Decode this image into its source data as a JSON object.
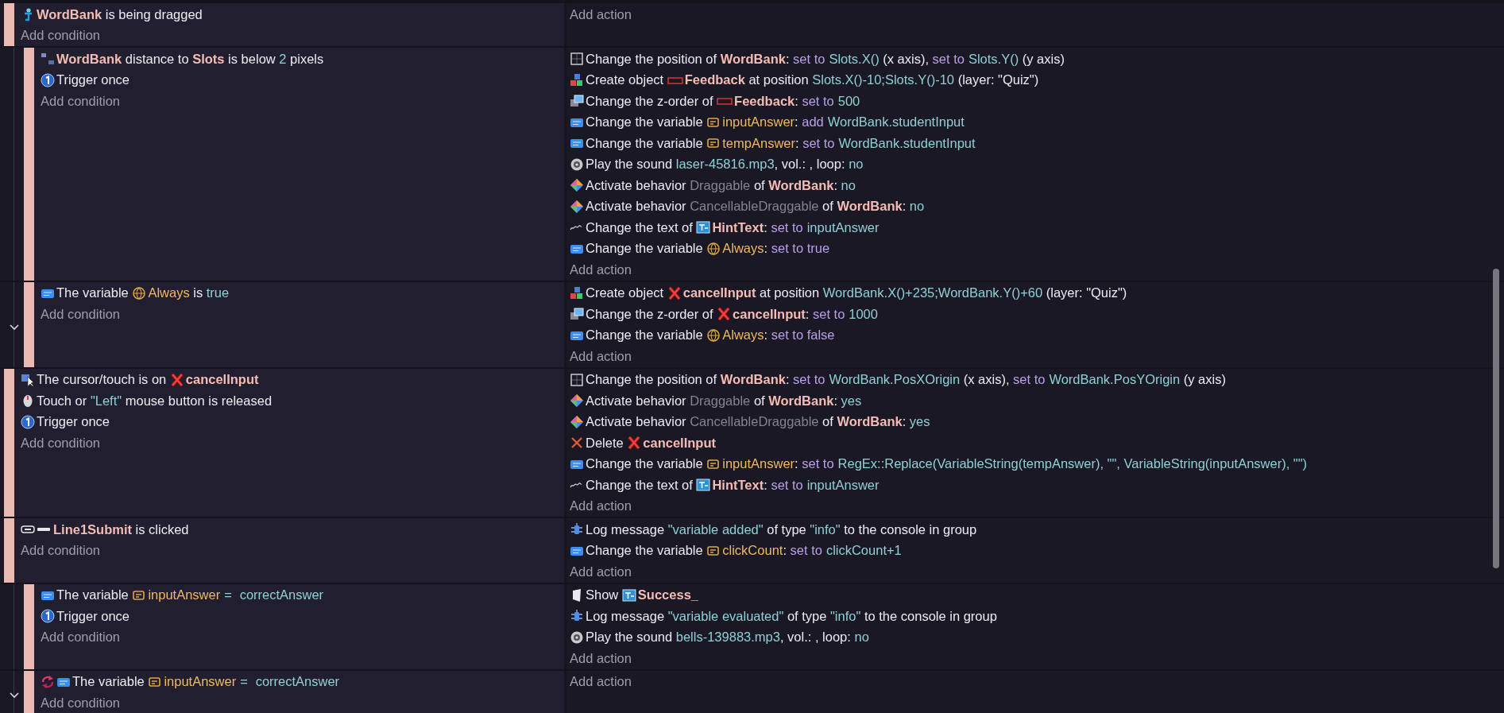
{
  "events": [
    {
      "conditions": [
        {
          "kind": "drag",
          "segments": [
            {
              "kind": "object",
              "text": "WordBank"
            },
            {
              "kind": "plain",
              "text": " is being dragged"
            }
          ]
        }
      ],
      "add_condition": "Add condition",
      "add_action": "Add action",
      "children": [
        {
          "conditions": [
            {
              "kind": "distance",
              "segments": [
                {
                  "kind": "object",
                  "text": "WordBank"
                },
                {
                  "kind": "plain",
                  "text": " distance to "
                },
                {
                  "kind": "object",
                  "text": "Slots"
                },
                {
                  "kind": "plain",
                  "text": " is below "
                },
                {
                  "kind": "value",
                  "text": "2"
                },
                {
                  "kind": "plain",
                  "text": " pixels"
                }
              ]
            },
            {
              "kind": "trigger",
              "segments": [
                {
                  "kind": "plain",
                  "text": "Trigger once"
                }
              ]
            }
          ],
          "add_condition": "Add condition",
          "actions": [
            {
              "kind": "position",
              "segments": [
                {
                  "kind": "plain",
                  "text": "Change the position of "
                },
                {
                  "kind": "object",
                  "text": "WordBank"
                },
                {
                  "kind": "plain",
                  "text": ": "
                },
                {
                  "kind": "operator",
                  "text": "set to"
                },
                {
                  "kind": "value",
                  "text": "Slots.X()"
                },
                {
                  "kind": "plain",
                  "text": " (x axis), "
                },
                {
                  "kind": "operator",
                  "text": "set to"
                },
                {
                  "kind": "value",
                  "text": "Slots.Y()"
                },
                {
                  "kind": "plain",
                  "text": " (y axis)"
                }
              ]
            },
            {
              "kind": "create",
              "segments": [
                {
                  "kind": "plain",
                  "text": "Create object "
                },
                {
                  "kind": "frame"
                },
                {
                  "kind": "object",
                  "text": "Feedback"
                },
                {
                  "kind": "plain",
                  "text": " at position "
                },
                {
                  "kind": "value",
                  "text": "Slots.X()-10;Slots.Y()-10"
                },
                {
                  "kind": "plain",
                  "text": " (layer: \"Quiz\")"
                }
              ]
            },
            {
              "kind": "zorder",
              "segments": [
                {
                  "kind": "plain",
                  "text": "Change the z-order of "
                },
                {
                  "kind": "frame"
                },
                {
                  "kind": "object",
                  "text": "Feedback"
                },
                {
                  "kind": "plain",
                  "text": ": "
                },
                {
                  "kind": "operator",
                  "text": "set to"
                },
                {
                  "kind": "value",
                  "text": "500"
                }
              ]
            },
            {
              "kind": "variable",
              "segments": [
                {
                  "kind": "plain",
                  "text": "Change the variable "
                },
                {
                  "kind": "scenevar"
                },
                {
                  "kind": "variable",
                  "text": "inputAnswer"
                },
                {
                  "kind": "plain",
                  "text": ": "
                },
                {
                  "kind": "operator",
                  "text": "add"
                },
                {
                  "kind": "value",
                  "text": "WordBank.studentInput"
                }
              ]
            },
            {
              "kind": "variable",
              "segments": [
                {
                  "kind": "plain",
                  "text": "Change the variable "
                },
                {
                  "kind": "scenevar"
                },
                {
                  "kind": "variable",
                  "text": "tempAnswer"
                },
                {
                  "kind": "plain",
                  "text": ": "
                },
                {
                  "kind": "operator",
                  "text": "set to"
                },
                {
                  "kind": "value",
                  "text": "WordBank.studentInput"
                }
              ]
            },
            {
              "kind": "sound",
              "segments": [
                {
                  "kind": "plain",
                  "text": "Play the sound "
                },
                {
                  "kind": "value",
                  "text": "laser-45816.mp3"
                },
                {
                  "kind": "plain",
                  "text": ", vol.: , loop: "
                },
                {
                  "kind": "value",
                  "text": "no"
                }
              ]
            },
            {
              "kind": "behavior",
              "segments": [
                {
                  "kind": "plain",
                  "text": "Activate behavior "
                },
                {
                  "kind": "behavior",
                  "text": "Draggable"
                },
                {
                  "kind": "plain",
                  "text": " of "
                },
                {
                  "kind": "object",
                  "text": "WordBank"
                },
                {
                  "kind": "plain",
                  "text": ": "
                },
                {
                  "kind": "value",
                  "text": "no"
                }
              ]
            },
            {
              "kind": "behavior",
              "segments": [
                {
                  "kind": "plain",
                  "text": "Activate behavior "
                },
                {
                  "kind": "behavior",
                  "text": "CancellableDraggable"
                },
                {
                  "kind": "plain",
                  "text": " of "
                },
                {
                  "kind": "object",
                  "text": "WordBank"
                },
                {
                  "kind": "plain",
                  "text": ": "
                },
                {
                  "kind": "value",
                  "text": "no"
                }
              ]
            },
            {
              "kind": "text",
              "segments": [
                {
                  "kind": "plain",
                  "text": "Change the text of "
                },
                {
                  "kind": "textbox"
                },
                {
                  "kind": "object",
                  "text": "HintText"
                },
                {
                  "kind": "plain",
                  "text": ": "
                },
                {
                  "kind": "operator",
                  "text": "set to"
                },
                {
                  "kind": "value",
                  "text": "inputAnswer"
                }
              ]
            },
            {
              "kind": "variable",
              "segments": [
                {
                  "kind": "plain",
                  "text": "Change the variable "
                },
                {
                  "kind": "globe"
                },
                {
                  "kind": "variable",
                  "text": "Always"
                },
                {
                  "kind": "plain",
                  "text": ": "
                },
                {
                  "kind": "operator",
                  "text": "set to true"
                }
              ]
            }
          ],
          "add_action": "Add action"
        },
        {
          "conditions": [
            {
              "kind": "variable",
              "segments": [
                {
                  "kind": "plain",
                  "text": "The variable "
                },
                {
                  "kind": "globe"
                },
                {
                  "kind": "variable",
                  "text": "Always"
                },
                {
                  "kind": "plain",
                  "text": " is "
                },
                {
                  "kind": "value",
                  "text": "true"
                }
              ]
            }
          ],
          "add_condition": "Add condition",
          "actions": [
            {
              "kind": "create",
              "segments": [
                {
                  "kind": "plain",
                  "text": "Create object "
                },
                {
                  "kind": "cross"
                },
                {
                  "kind": "object",
                  "text": "cancelInput"
                },
                {
                  "kind": "plain",
                  "text": " at position "
                },
                {
                  "kind": "value",
                  "text": "WordBank.X()+235;WordBank.Y()+60"
                },
                {
                  "kind": "plain",
                  "text": " (layer: \"Quiz\")"
                }
              ]
            },
            {
              "kind": "zorder",
              "segments": [
                {
                  "kind": "plain",
                  "text": "Change the z-order of "
                },
                {
                  "kind": "cross"
                },
                {
                  "kind": "object",
                  "text": "cancelInput"
                },
                {
                  "kind": "plain",
                  "text": ": "
                },
                {
                  "kind": "operator",
                  "text": "set to"
                },
                {
                  "kind": "value",
                  "text": "1000"
                }
              ]
            },
            {
              "kind": "variable",
              "segments": [
                {
                  "kind": "plain",
                  "text": "Change the variable "
                },
                {
                  "kind": "globe"
                },
                {
                  "kind": "variable",
                  "text": "Always"
                },
                {
                  "kind": "plain",
                  "text": ": "
                },
                {
                  "kind": "operator",
                  "text": "set to false"
                }
              ]
            }
          ],
          "add_action": "Add action"
        }
      ]
    },
    {
      "conditions": [
        {
          "kind": "cursor",
          "segments": [
            {
              "kind": "plain",
              "text": "The cursor/touch is on "
            },
            {
              "kind": "cross"
            },
            {
              "kind": "object",
              "text": "cancelInput"
            }
          ]
        },
        {
          "kind": "mouse",
          "segments": [
            {
              "kind": "plain",
              "text": "Touch or "
            },
            {
              "kind": "value",
              "text": "\"Left\""
            },
            {
              "kind": "plain",
              "text": " mouse button is released"
            }
          ]
        },
        {
          "kind": "trigger",
          "segments": [
            {
              "kind": "plain",
              "text": "Trigger once"
            }
          ]
        }
      ],
      "add_condition": "Add condition",
      "actions": [
        {
          "kind": "position",
          "segments": [
            {
              "kind": "plain",
              "text": "Change the position of "
            },
            {
              "kind": "object",
              "text": "WordBank"
            },
            {
              "kind": "plain",
              "text": ": "
            },
            {
              "kind": "operator",
              "text": "set to"
            },
            {
              "kind": "value",
              "text": "WordBank.PosXOrigin"
            },
            {
              "kind": "plain",
              "text": " (x axis), "
            },
            {
              "kind": "operator",
              "text": "set to"
            },
            {
              "kind": "value",
              "text": "WordBank.PosYOrigin"
            },
            {
              "kind": "plain",
              "text": " (y axis)"
            }
          ]
        },
        {
          "kind": "behavior",
          "segments": [
            {
              "kind": "plain",
              "text": "Activate behavior "
            },
            {
              "kind": "behavior",
              "text": "Draggable"
            },
            {
              "kind": "plain",
              "text": " of "
            },
            {
              "kind": "object",
              "text": "WordBank"
            },
            {
              "kind": "plain",
              "text": ": "
            },
            {
              "kind": "value",
              "text": "yes"
            }
          ]
        },
        {
          "kind": "behavior",
          "segments": [
            {
              "kind": "plain",
              "text": "Activate behavior "
            },
            {
              "kind": "behavior",
              "text": "CancellableDraggable"
            },
            {
              "kind": "plain",
              "text": " of "
            },
            {
              "kind": "object",
              "text": "WordBank"
            },
            {
              "kind": "plain",
              "text": ": "
            },
            {
              "kind": "value",
              "text": "yes"
            }
          ]
        },
        {
          "kind": "delete",
          "segments": [
            {
              "kind": "plain",
              "text": "Delete "
            },
            {
              "kind": "cross"
            },
            {
              "kind": "object",
              "text": "cancelInput"
            }
          ]
        },
        {
          "kind": "variable",
          "segments": [
            {
              "kind": "plain",
              "text": "Change the variable "
            },
            {
              "kind": "scenevar"
            },
            {
              "kind": "variable",
              "text": "inputAnswer"
            },
            {
              "kind": "plain",
              "text": ": "
            },
            {
              "kind": "operator",
              "text": "set to"
            },
            {
              "kind": "value",
              "text": "RegEx::Replace(VariableString(tempAnswer), \"\", VariableString(inputAnswer), \"\")"
            }
          ]
        },
        {
          "kind": "text",
          "segments": [
            {
              "kind": "plain",
              "text": "Change the text of "
            },
            {
              "kind": "textbox"
            },
            {
              "kind": "object",
              "text": "HintText"
            },
            {
              "kind": "plain",
              "text": ": "
            },
            {
              "kind": "operator",
              "text": "set to"
            },
            {
              "kind": "value",
              "text": "inputAnswer"
            }
          ]
        }
      ],
      "add_action": "Add action"
    },
    {
      "conditions": [
        {
          "kind": "button",
          "segments": [
            {
              "kind": "dash"
            },
            {
              "kind": "object",
              "text": "Line1Submit"
            },
            {
              "kind": "plain",
              "text": " is clicked"
            }
          ]
        }
      ],
      "add_condition": "Add condition",
      "actions": [
        {
          "kind": "log",
          "segments": [
            {
              "kind": "plain",
              "text": "Log message "
            },
            {
              "kind": "value",
              "text": "\"variable added\""
            },
            {
              "kind": "plain",
              "text": " of type "
            },
            {
              "kind": "value",
              "text": "\"info\""
            },
            {
              "kind": "plain",
              "text": " to the console in group"
            }
          ]
        },
        {
          "kind": "variable",
          "segments": [
            {
              "kind": "plain",
              "text": "Change the variable "
            },
            {
              "kind": "scenevar"
            },
            {
              "kind": "variable",
              "text": "clickCount"
            },
            {
              "kind": "plain",
              "text": ": "
            },
            {
              "kind": "operator",
              "text": "set to"
            },
            {
              "kind": "value",
              "text": "clickCount+1"
            }
          ]
        }
      ],
      "add_action": "Add action",
      "children": [
        {
          "conditions": [
            {
              "kind": "variable",
              "segments": [
                {
                  "kind": "plain",
                  "text": "The variable "
                },
                {
                  "kind": "scenevar"
                },
                {
                  "kind": "variable",
                  "text": "inputAnswer"
                },
                {
                  "kind": "value",
                  "text": "="
                },
                {
                  "kind": "value",
                  "text": "correctAnswer"
                }
              ]
            },
            {
              "kind": "trigger",
              "segments": [
                {
                  "kind": "plain",
                  "text": "Trigger once"
                }
              ]
            }
          ],
          "add_condition": "Add condition",
          "actions": [
            {
              "kind": "show",
              "segments": [
                {
                  "kind": "plain",
                  "text": "Show "
                },
                {
                  "kind": "textbox"
                },
                {
                  "kind": "object",
                  "text": "Success_"
                }
              ]
            },
            {
              "kind": "log",
              "segments": [
                {
                  "kind": "plain",
                  "text": "Log message "
                },
                {
                  "kind": "value",
                  "text": "\"variable evaluated\""
                },
                {
                  "kind": "plain",
                  "text": " of type "
                },
                {
                  "kind": "value",
                  "text": "\"info\""
                },
                {
                  "kind": "plain",
                  "text": " to the console in group"
                }
              ]
            },
            {
              "kind": "sound",
              "segments": [
                {
                  "kind": "plain",
                  "text": "Play the sound "
                },
                {
                  "kind": "value",
                  "text": "bells-139883.mp3"
                },
                {
                  "kind": "plain",
                  "text": ", vol.: , loop: "
                },
                {
                  "kind": "value",
                  "text": "no"
                }
              ]
            }
          ],
          "add_action": "Add action"
        },
        {
          "conditions": [
            {
              "kind": "cycle",
              "segments": [
                {
                  "kind": "varbadge"
                },
                {
                  "kind": "plain",
                  "text": "The variable "
                },
                {
                  "kind": "scenevar"
                },
                {
                  "kind": "variable",
                  "text": "inputAnswer"
                },
                {
                  "kind": "value",
                  "text": "="
                },
                {
                  "kind": "value",
                  "text": "correctAnswer"
                }
              ]
            }
          ],
          "add_condition": "Add condition",
          "add_action": "Add action"
        }
      ]
    }
  ]
}
